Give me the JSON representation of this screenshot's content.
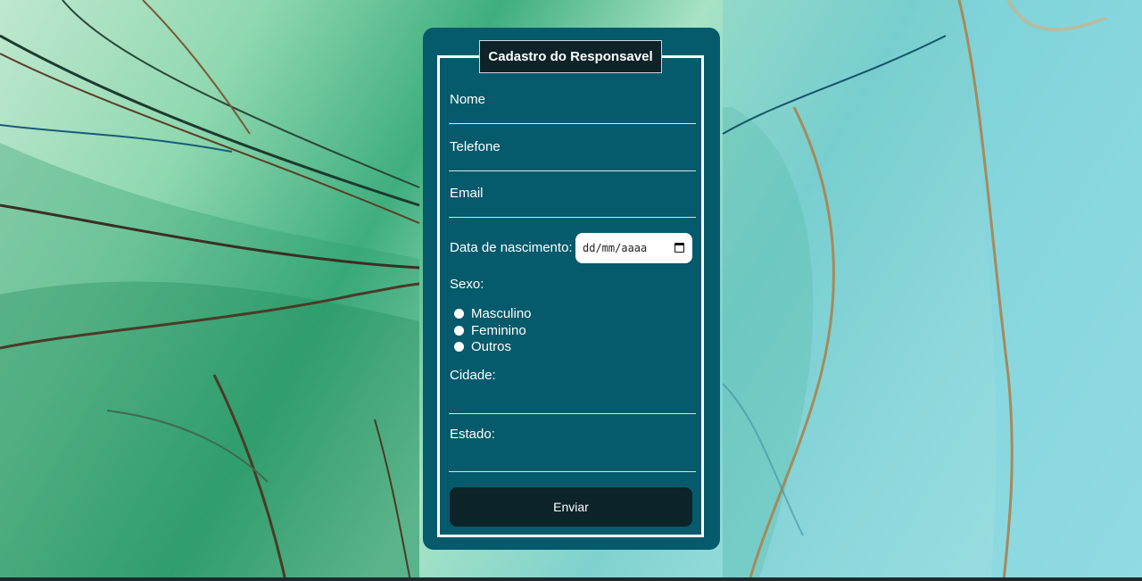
{
  "form": {
    "title": "Cadastro do Responsavel",
    "fields": {
      "nome": "Nome",
      "telefone": "Telefone",
      "email": "Email",
      "data_nascimento": "Data de nascimento:",
      "data_placeholder": "dd/mm/aaaa",
      "sexo": "Sexo:",
      "cidade": "Cidade:",
      "estado": "Estado:"
    },
    "sexo_options": [
      "Masculino",
      "Feminino",
      "Outros"
    ],
    "submit_label": "Enviar"
  },
  "icons": {
    "calendar": "calendar-icon"
  },
  "colors": {
    "card": "#055a6b",
    "legend_bg": "#0d2328",
    "button_bg": "#0b2329"
  }
}
